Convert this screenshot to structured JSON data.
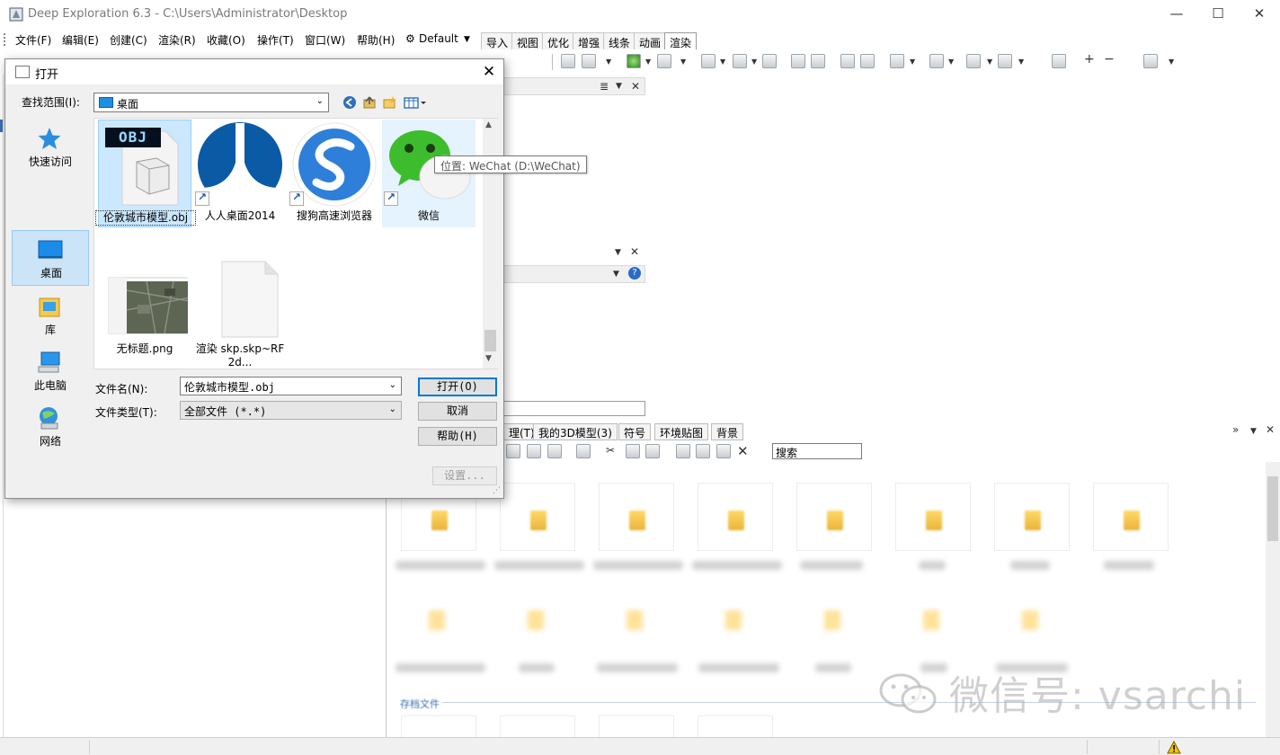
{
  "app": {
    "title": "Deep Exploration 6.3 - C:\\Users\\Administrator\\Desktop",
    "window_controls": {
      "minimize": "—",
      "maximize": "☐",
      "close": "✕"
    }
  },
  "menubar": {
    "items": [
      "文件(F)",
      "编辑(E)",
      "创建(C)",
      "渲染(R)",
      "收藏(O)",
      "操作(T)",
      "窗口(W)",
      "帮助(H)"
    ],
    "profile": "Default",
    "tabs": [
      "导入",
      "视图",
      "优化",
      "增强",
      "线条",
      "动画",
      "渲染"
    ],
    "active_tab": "渲染"
  },
  "library": {
    "tabs": [
      "理(T)",
      "我的3D模型(3)",
      "符号",
      "环境贴图",
      "背景"
    ],
    "search_value": "搜索",
    "section_label": "存档文件"
  },
  "watermark": {
    "text": "微信号: vsarchi"
  },
  "dialog": {
    "title": "打开",
    "close": "✕",
    "lookin_label": "查找范围(I):",
    "lookin_value": "桌面",
    "places": [
      {
        "label": "快速访问",
        "icon": "star-icon"
      },
      {
        "label": "桌面",
        "icon": "desktop-icon"
      },
      {
        "label": "库",
        "icon": "library-icon"
      },
      {
        "label": "此电脑",
        "icon": "computer-icon"
      },
      {
        "label": "网络",
        "icon": "network-icon"
      }
    ],
    "files": [
      {
        "label": "伦敦城市模型.obj",
        "badge": "OBJ"
      },
      {
        "label": "人人桌面2014"
      },
      {
        "label": "搜狗高速浏览器"
      },
      {
        "label": "微信"
      },
      {
        "label": "无标题.png"
      },
      {
        "label": "渲染 skp.skp~RF2d..."
      }
    ],
    "tooltip": "位置: WeChat (D:\\WeChat)",
    "filename_label": "文件名(N):",
    "filename_value": "伦敦城市模型.obj",
    "filetype_label": "文件类型(T):",
    "filetype_value": "全部文件 (*.*)",
    "buttons": {
      "open": "打开(O)",
      "cancel": "取消",
      "help": "帮助(H)",
      "settings": "设置..."
    }
  }
}
